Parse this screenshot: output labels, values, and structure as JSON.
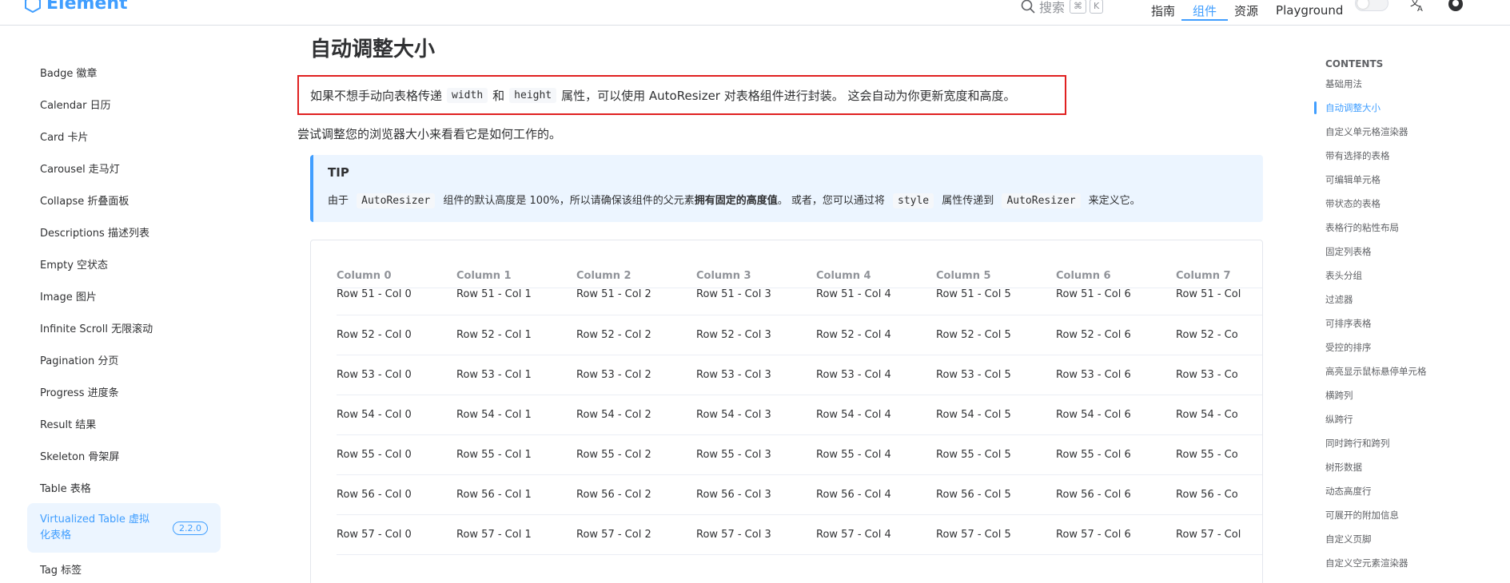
{
  "navbar": {
    "logo_text": "Element",
    "search_label": "搜索",
    "search_kbd": [
      "⌘",
      "K"
    ],
    "links": [
      {
        "label": "指南",
        "active": false
      },
      {
        "label": "组件",
        "active": true
      },
      {
        "label": "资源",
        "active": false
      },
      {
        "label": "Playground",
        "active": false
      }
    ],
    "accent_color": "#409eff"
  },
  "sidebar": {
    "items": [
      {
        "label": "Badge 徽章"
      },
      {
        "label": "Calendar 日历"
      },
      {
        "label": "Card 卡片"
      },
      {
        "label": "Carousel 走马灯"
      },
      {
        "label": "Collapse 折叠面板"
      },
      {
        "label": "Descriptions 描述列表"
      },
      {
        "label": "Empty 空状态"
      },
      {
        "label": "Image 图片"
      },
      {
        "label": "Infinite Scroll 无限滚动"
      },
      {
        "label": "Pagination 分页"
      },
      {
        "label": "Progress 进度条"
      },
      {
        "label": "Result 结果"
      },
      {
        "label": "Skeleton 骨架屏"
      },
      {
        "label": "Table 表格"
      },
      {
        "label": "Virtualized Table 虚拟化表格",
        "badge": "2.2.0",
        "active": true
      },
      {
        "label": "Tag 标签"
      }
    ]
  },
  "main": {
    "title": "自动调整大小",
    "highlight": {
      "part1": "如果不想手动向表格传递",
      "code1": "width",
      "part2": "和",
      "code2": "height",
      "part3": "属性，可以使用 AutoResizer 对表格组件进行封装。 这会自动为你更新宽度和高度。"
    },
    "p2": "尝试调整您的浏览器大小来看看它是如何工作的。",
    "tip": {
      "title": "TIP",
      "part1": "由于",
      "code1": "AutoResizer",
      "part2": "组件的默认高度是 100%，所以请确保该组件的父元素",
      "bold": "拥有固定的高度值",
      "part3": "。 或者，您可以通过将",
      "code2": "style",
      "part4": "属性传递到",
      "code3": "AutoResizer",
      "part5": "来定义它。"
    },
    "table": {
      "headers": [
        "Column 0",
        "Column 1",
        "Column 2",
        "Column 3",
        "Column 4",
        "Column 5",
        "Column 6",
        "Column 7"
      ],
      "rows": [
        [
          "Row 51 - Col 0",
          "Row 51 - Col 1",
          "Row 51 - Col 2",
          "Row 51 - Col 3",
          "Row 51 - Col 4",
          "Row 51 - Col 5",
          "Row 51 - Col 6",
          "Row 51 - Col"
        ],
        [
          "Row 52 - Col 0",
          "Row 52 - Col 1",
          "Row 52 - Col 2",
          "Row 52 - Col 3",
          "Row 52 - Col 4",
          "Row 52 - Col 5",
          "Row 52 - Col 6",
          "Row 52 - Co"
        ],
        [
          "Row 53 - Col 0",
          "Row 53 - Col 1",
          "Row 53 - Col 2",
          "Row 53 - Col 3",
          "Row 53 - Col 4",
          "Row 53 - Col 5",
          "Row 53 - Col 6",
          "Row 53 - Co"
        ],
        [
          "Row 54 - Col 0",
          "Row 54 - Col 1",
          "Row 54 - Col 2",
          "Row 54 - Col 3",
          "Row 54 - Col 4",
          "Row 54 - Col 5",
          "Row 54 - Col 6",
          "Row 54 - Co"
        ],
        [
          "Row 55 - Col 0",
          "Row 55 - Col 1",
          "Row 55 - Col 2",
          "Row 55 - Col 3",
          "Row 55 - Col 4",
          "Row 55 - Col 5",
          "Row 55 - Col 6",
          "Row 55 - Co"
        ],
        [
          "Row 56 - Col 0",
          "Row 56 - Col 1",
          "Row 56 - Col 2",
          "Row 56 - Col 3",
          "Row 56 - Col 4",
          "Row 56 - Col 5",
          "Row 56 - Col 6",
          "Row 56 - Co"
        ],
        [
          "Row 57 - Col 0",
          "Row 57 - Col 1",
          "Row 57 - Col 2",
          "Row 57 - Col 3",
          "Row 57 - Col 4",
          "Row 57 - Col 5",
          "Row 57 - Col 6",
          "Row 57 - Col"
        ]
      ]
    },
    "highlight_border_color": "#e02020"
  },
  "toc": {
    "title": "CONTENTS",
    "items": [
      {
        "label": "基础用法"
      },
      {
        "label": "自动调整大小",
        "active": true
      },
      {
        "label": "自定义单元格渲染器"
      },
      {
        "label": "带有选择的表格"
      },
      {
        "label": "可编辑单元格"
      },
      {
        "label": "带状态的表格"
      },
      {
        "label": "表格行的粘性布局"
      },
      {
        "label": "固定列表格"
      },
      {
        "label": "表头分组"
      },
      {
        "label": "过滤器"
      },
      {
        "label": "可排序表格"
      },
      {
        "label": "受控的排序"
      },
      {
        "label": "高亮显示鼠标悬停单元格"
      },
      {
        "label": "横跨列"
      },
      {
        "label": "纵跨行"
      },
      {
        "label": "同时跨行和跨列"
      },
      {
        "label": "树形数据"
      },
      {
        "label": "动态高度行"
      },
      {
        "label": "可展开的附加信息"
      },
      {
        "label": "自定义页脚"
      },
      {
        "label": "自定义空元素渲染器"
      }
    ]
  }
}
